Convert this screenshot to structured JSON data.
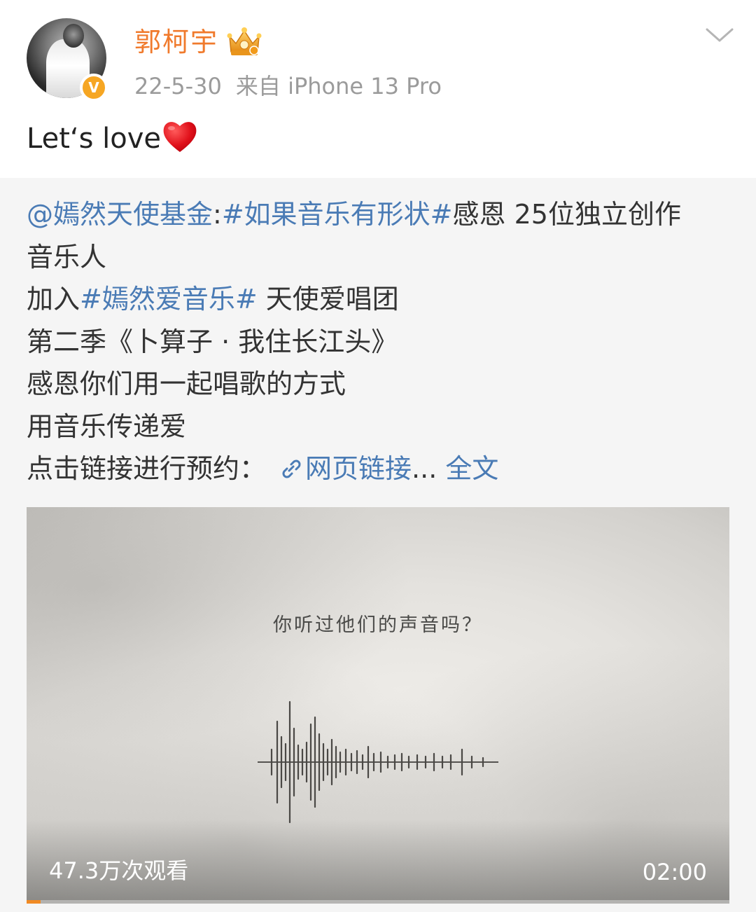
{
  "header": {
    "username": "郭柯宇",
    "date": "22-5-30",
    "source": "来自 iPhone 13 Pro",
    "verified_mark": "V"
  },
  "post": {
    "text": "Let‘s love"
  },
  "retweet": {
    "mention": "@嫣然天使基金",
    "colon": ":",
    "hashtag1": "#如果音乐有形状#",
    "line1_rest": "感恩 25位独立创作",
    "line2": "音乐人",
    "line3_prefix": "加入",
    "hashtag2": "#嫣然爱音乐#",
    "line3_rest": " 天使爱唱团",
    "line4": "第二季《卜算子 · 我住长江头》",
    "line5": "感恩你们用一起唱歌的方式",
    "line6": "用音乐传递爱",
    "line7_prefix": "点击链接进行预约：",
    "link_label": "网页链接",
    "ellipsis": "...",
    "full_text": " 全文"
  },
  "video": {
    "caption": "你听过他们的声音吗？",
    "views": "47.3万次观看",
    "duration": "02:00",
    "progress": 0.02
  },
  "colors": {
    "username": "#f07a2c",
    "link_blue": "#4a7bb5",
    "badge": "#f6a623",
    "progress": "#f08a24"
  },
  "icons": {
    "crown": "crown-icon",
    "heart": "heart-icon",
    "link": "link-icon",
    "chevron": "chevron-down-icon"
  }
}
